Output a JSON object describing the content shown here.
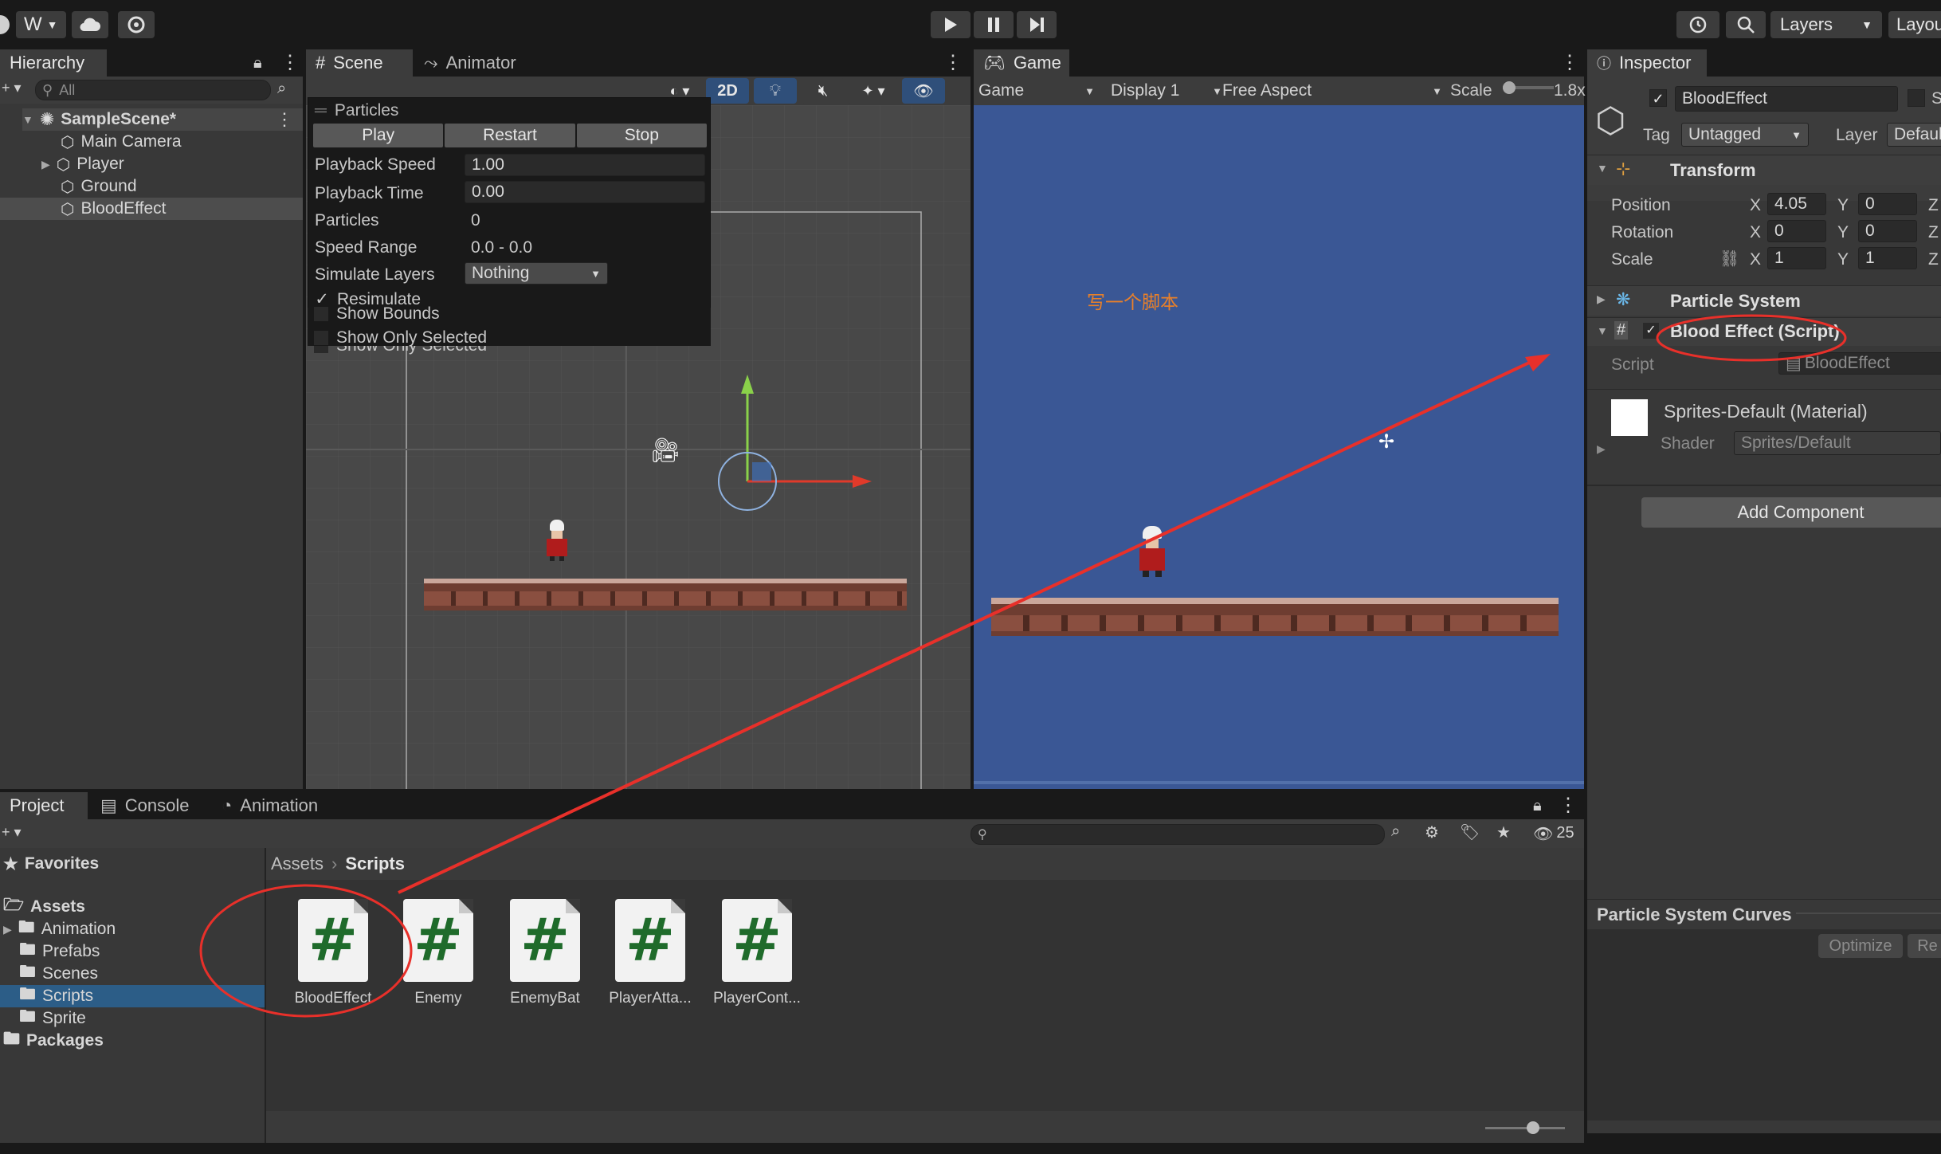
{
  "toolbar": {
    "account_label": "W",
    "layers_label": "Layers",
    "layout_label": "Layou"
  },
  "hierarchy": {
    "tab_label": "Hierarchy",
    "search_placeholder": "All",
    "scene_name": "SampleScene*",
    "items": [
      "Main Camera",
      "Player",
      "Ground",
      "BloodEffect"
    ]
  },
  "scene_view": {
    "tabs": [
      "Scene",
      "Animator"
    ],
    "mode_2d": "2D",
    "particles_overlay": {
      "title": "Particles",
      "buttons": [
        "Play",
        "Restart",
        "Stop"
      ],
      "rows": [
        {
          "label": "Playback Speed",
          "value": "1.00"
        },
        {
          "label": "Playback Time",
          "value": "0.00"
        },
        {
          "label": "Particles",
          "value": "0"
        },
        {
          "label": "Speed Range",
          "value": "0.0 - 0.0"
        },
        {
          "label": "Simulate Layers",
          "value": "Nothing"
        }
      ],
      "checkboxes": [
        {
          "label": "Resimulate",
          "checked": true
        },
        {
          "label": "Show Bounds",
          "checked": false
        },
        {
          "label": "Show Only Selected",
          "checked": false
        }
      ]
    }
  },
  "game_view": {
    "tab_label": "Game",
    "game_dropdown": "Game",
    "display_dropdown": "Display 1",
    "aspect_dropdown": "Free Aspect",
    "scale_label": "Scale",
    "scale_value": "1.8x",
    "annotation_text": "写一个脚本",
    "background_color": "#3a5795"
  },
  "inspector": {
    "tab_label": "Inspector",
    "object_name": "BloodEffect",
    "static_label": "S",
    "tag_label": "Tag",
    "tag_value": "Untagged",
    "layer_label": "Layer",
    "layer_value": "Defaul",
    "transform": {
      "title": "Transform",
      "rows": [
        {
          "label": "Position",
          "x": "4.05",
          "y": "0"
        },
        {
          "label": "Rotation",
          "x": "0",
          "y": "0"
        },
        {
          "label": "Scale",
          "x": "1",
          "y": "1"
        }
      ],
      "axis_labels": [
        "X",
        "Y",
        "Z"
      ]
    },
    "particle_system_title": "Particle System",
    "script_component": {
      "title": "Blood Effect (Script)",
      "script_label": "Script",
      "script_value": "BloodEffect"
    },
    "material": {
      "name": "Sprites-Default (Material)",
      "shader_label": "Shader",
      "shader_value": "Sprites/Default"
    },
    "add_component_label": "Add Component",
    "curves": {
      "title": "Particle System Curves",
      "optimize_label": "Optimize",
      "remove_label": "Re"
    }
  },
  "project": {
    "tabs": [
      "Project",
      "Console",
      "Animation"
    ],
    "hidden_count": "25",
    "favorites_label": "Favorites",
    "assets_label": "Assets",
    "folders": [
      "Animation",
      "Prefabs",
      "Scenes",
      "Scripts",
      "Sprite"
    ],
    "packages_label": "Packages",
    "breadcrumb": [
      "Assets",
      "Scripts"
    ],
    "files": [
      "BloodEffect",
      "Enemy",
      "EnemyBat",
      "PlayerAtta...",
      "PlayerCont..."
    ]
  },
  "colors": {
    "accent_selected": "#2c5d87",
    "annotation_red": "#e8302a",
    "annotation_text": "#e8802a"
  }
}
